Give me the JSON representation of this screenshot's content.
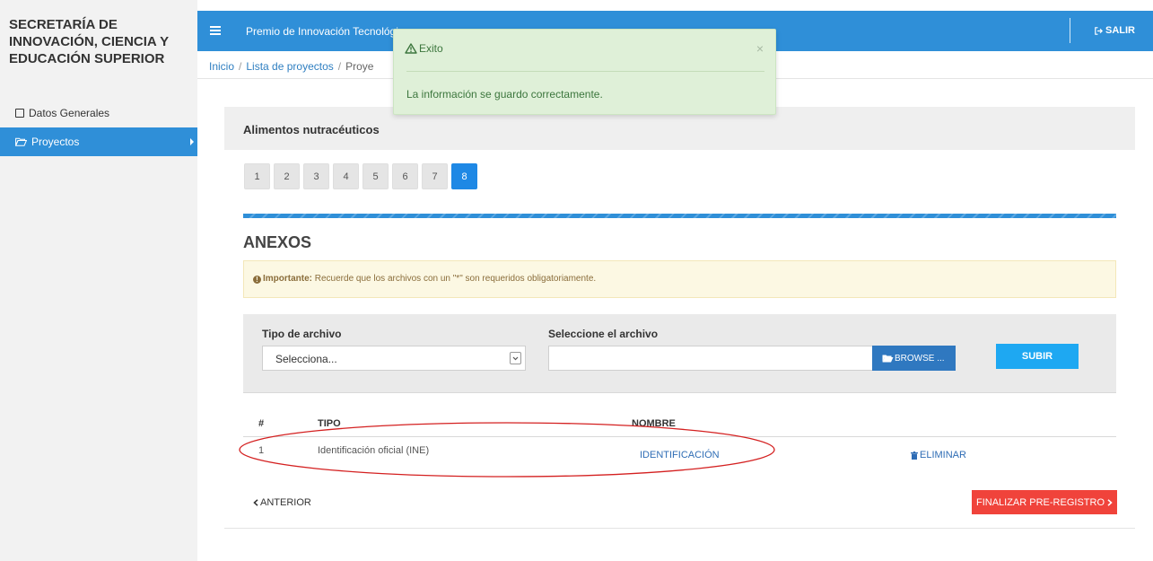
{
  "sidebar": {
    "brand": "SECRETARÍA DE INNOVACIÓN, CIENCIA Y EDUCACIÓN SUPERIOR",
    "items": [
      {
        "label": "Datos Generales",
        "icon": "document-icon"
      },
      {
        "label": "Proyectos",
        "icon": "folder-open-icon",
        "active": true
      }
    ]
  },
  "header": {
    "title": "Premio de Innovación Tecnológica Sonorense",
    "logout_label": "SALIR"
  },
  "breadcrumb": {
    "items": [
      "Inicio",
      "Lista de proyectos",
      "Proyecto"
    ]
  },
  "toast": {
    "title": "Exito",
    "close": "×",
    "message": "La información se guardo correctamente."
  },
  "main": {
    "project_title": "Alimentos nutracéuticos",
    "steps": [
      "1",
      "2",
      "3",
      "4",
      "5",
      "6",
      "7",
      "8"
    ],
    "active_step": "8",
    "section_title": "ANEXOS",
    "notice": {
      "strong": "Importante:",
      "text": " Recuerde que los archivos con un \"*\" son requeridos obligatoriamente."
    },
    "upload": {
      "type_label": "Tipo de archivo",
      "type_value": "Selecciona...",
      "file_label": "Seleccione el archivo",
      "file_value": "",
      "browse_label": "BROWSE ...",
      "upload_label": "SUBIR"
    },
    "table": {
      "headers": [
        "#",
        "TIPO",
        "NOMBRE"
      ],
      "rows": [
        {
          "num": "1",
          "type": "Identificación oficial (INE)",
          "name": "IDENTIFICACIÓN",
          "action": "ELIMINAR"
        }
      ]
    },
    "prev_label": "ANTERIOR",
    "finish_label": "FINALIZAR PRE-REGISTRO"
  },
  "colors": {
    "primary": "#2f8fd8",
    "success_bg": "#dff0d8",
    "warning_bg": "#fcf8e3",
    "danger": "#f0433b",
    "annotation": "#d42020"
  }
}
